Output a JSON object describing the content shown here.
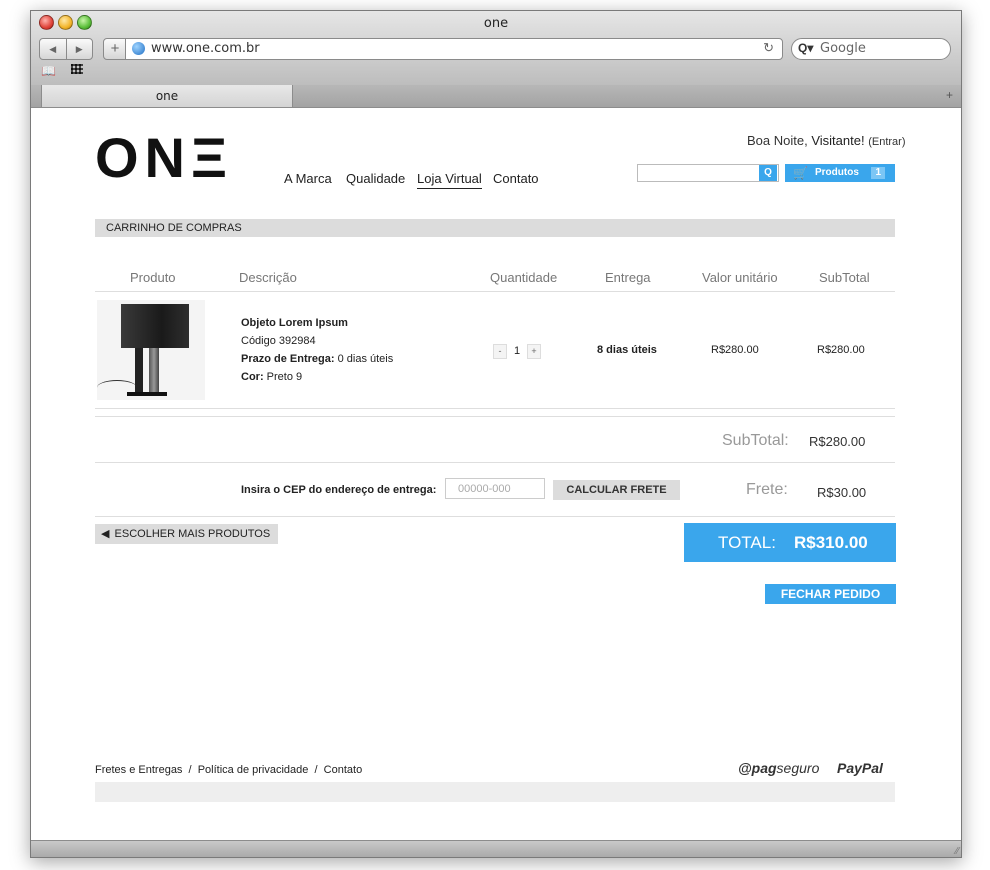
{
  "window": {
    "title": "one",
    "url": "www.one.com.br",
    "search_placeholder": "Google",
    "tab_label": "one"
  },
  "header": {
    "logo": "ONΞ",
    "nav": [
      "A Marca",
      "Qualidade",
      "Loja Virtual",
      "Contato"
    ],
    "greeting_prefix": "Boa Noite, ",
    "greeting_name": "Visitante!",
    "greeting_login": "(Entrar)",
    "cart_label": "Produtos",
    "cart_count": "1"
  },
  "cart": {
    "section_title": "CARRINHO DE COMPRAS",
    "columns": [
      "Produto",
      "Descrição",
      "Quantidade",
      "Entrega",
      "Valor unitário",
      "SubTotal"
    ],
    "item": {
      "name": "Objeto Lorem Ipsum",
      "code": "Código 392984",
      "delivery_label": "Prazo de Entrega:",
      "delivery_value": " 0 dias úteis",
      "color_label": "Cor:",
      "color_value": " Preto 9",
      "quantity": "1",
      "quantity_minus": "-",
      "quantity_plus": "+",
      "delivery": "8 dias úteis",
      "unit_price": "R$280.00",
      "subtotal": "R$280.00"
    },
    "subtotal_label": "SubTotal:",
    "subtotal_value": "R$280.00",
    "cep_label": "Insira o CEP do endereço de entrega:",
    "cep_placeholder": "00000-000",
    "calc_button": "CALCULAR FRETE",
    "frete_label": "Frete:",
    "frete_value": "R$30.00",
    "back_button": "ESCOLHER MAIS PRODUTOS",
    "back_icon": "◀",
    "total_label": "TOTAL:",
    "total_value": "R$310.00",
    "checkout_button": "FECHAR PEDIDO"
  },
  "footer": {
    "links": "Fretes e Entregas  /  Política de privacidade  /  Contato",
    "pagseguro_symbol": "@",
    "pagseguro_bold": "pag",
    "pagseguro_light": "seguro",
    "paypal": "PayPal"
  },
  "colors": {
    "accent": "#3aa6ec",
    "bar_gray": "#dcdcdc"
  }
}
